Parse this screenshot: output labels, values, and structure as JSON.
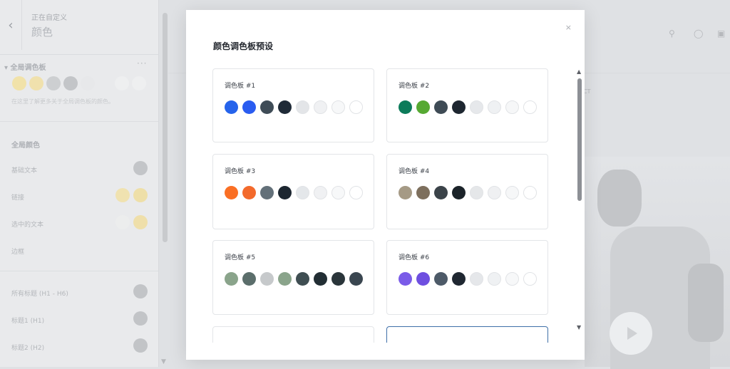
{
  "customizer": {
    "subtitle": "正在自定义",
    "title": "颜色",
    "global_palette_title": "全局调色板",
    "global_palette_note": "在这里了解更多关于全局调色板的颜色。",
    "global_colors_title": "全局颜色",
    "rows": [
      {
        "label": "基础文本"
      },
      {
        "label": "链接"
      },
      {
        "label": "选中的文本"
      },
      {
        "label": "边框"
      },
      {
        "label": "所有标题 (H1 - H6)"
      },
      {
        "label": "标题1 (H1)"
      },
      {
        "label": "标题2 (H2)"
      }
    ],
    "more_dots": "···",
    "back_icon": "chevron-left-icon"
  },
  "site": {
    "nav_fragment": "CT",
    "header_icons": [
      "search-icon",
      "user-icon",
      "cart-icon"
    ]
  },
  "modal": {
    "title": "颜色调色板预设",
    "close_label": "×",
    "palettes": [
      {
        "name": "调色板 #1",
        "colors": [
          "#2563eb",
          "#2a5cf0",
          "#3f4c57",
          "#1f2a37",
          "#e3e5e8",
          "#f0f1f3",
          "#f7f8f9",
          "#ffffff"
        ]
      },
      {
        "name": "调色板 #2",
        "colors": [
          "#0c7b5a",
          "#56a932",
          "#3e4b55",
          "#1d2630",
          "#e6e8eb",
          "#eff1f3",
          "#f6f7f8",
          "#ffffff"
        ]
      },
      {
        "name": "调色板 #3",
        "colors": [
          "#fa6f24",
          "#f36a2c",
          "#637079",
          "#1c2630",
          "#e4e7ea",
          "#f0f1f3",
          "#f7f8f9",
          "#ffffff"
        ]
      },
      {
        "name": "调色板 #4",
        "colors": [
          "#a59a85",
          "#7d6f5d",
          "#3b4349",
          "#1b2329",
          "#e5e7e9",
          "#eff0f2",
          "#f6f7f8",
          "#ffffff"
        ]
      },
      {
        "name": "调色板 #5",
        "colors": [
          "#8aa48b",
          "#5b6e6b",
          "#c6c9cb",
          "#8aa48b",
          "#3f4e52",
          "#222e34",
          "#2a353a",
          "#3a4650"
        ]
      },
      {
        "name": "调色板 #6",
        "colors": [
          "#7a5be8",
          "#6e4fe0",
          "#4d5a68",
          "#1f2731",
          "#e5e7ea",
          "#eff1f3",
          "#f7f8f9",
          "#ffffff"
        ]
      },
      {
        "name": "",
        "colors": []
      },
      {
        "name": "",
        "colors": []
      }
    ]
  },
  "colors": {
    "accent_border": "#3f6fa8",
    "backdrop": "#dfe1e4"
  }
}
